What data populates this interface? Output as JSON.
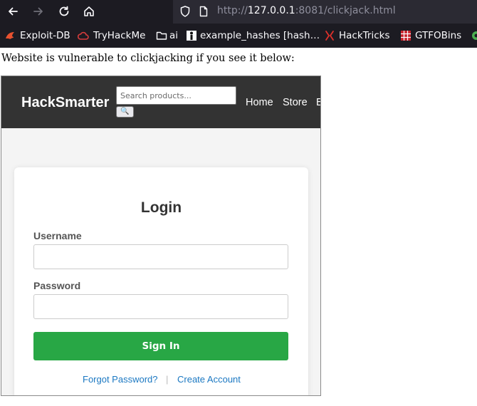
{
  "browser": {
    "url_prefix": "http://",
    "url_host": "127.0.0.1",
    "url_path": ":8081/clickjack.html",
    "bookmarks": [
      {
        "label": "Exploit-DB",
        "icon": "exploitdb-icon"
      },
      {
        "label": "TryHackMe",
        "icon": "tryhackme-icon"
      },
      {
        "label": "ai",
        "icon": "folder-icon"
      },
      {
        "label": "example_hashes [hash…",
        "icon": "hashcat-icon"
      },
      {
        "label": "HackTricks",
        "icon": "hacktricks-icon"
      },
      {
        "label": "GTFOBins",
        "icon": "gtfobins-icon"
      }
    ]
  },
  "page": {
    "heading": "Website is vulnerable to clickjacking if you see it below:"
  },
  "site": {
    "brand": "HackSmarter",
    "search_placeholder": "Search products...",
    "search_button": "🔍",
    "nav": [
      "Home",
      "Store",
      "B"
    ]
  },
  "login": {
    "title": "Login",
    "username_label": "Username",
    "password_label": "Password",
    "signin_label": "Sign In",
    "forgot_link": "Forgot Password?",
    "separator": "|",
    "create_link": "Create Account"
  },
  "colors": {
    "header_bg": "#333333",
    "signin_bg": "#28a745",
    "link": "#1b78c2",
    "chrome_bg": "#1c1b22"
  }
}
